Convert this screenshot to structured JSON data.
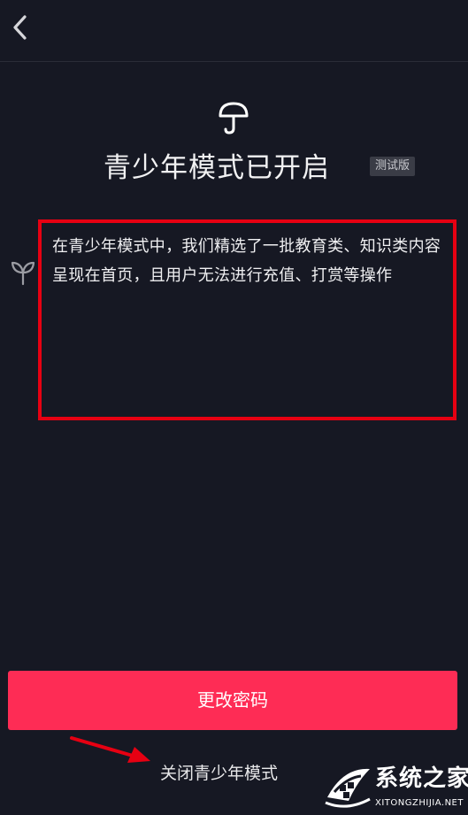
{
  "header": {
    "back_icon": "chevron-left-icon"
  },
  "hero": {
    "icon": "umbrella-icon",
    "title": "青少年模式已开启",
    "badge": "测试版"
  },
  "description": {
    "icon": "sprout-icon",
    "text": "在青少年模式中，我们精选了一批教育类、知识类内容呈现在首页，且用户无法进行充值、打赏等操作"
  },
  "actions": {
    "change_password_label": "更改密码",
    "close_mode_label": "关闭青少年模式"
  },
  "annotation": {
    "box_color": "#e60012",
    "arrow_color": "#e60012"
  },
  "watermark": {
    "name": "系统之家",
    "url": "XITONGZHIJIA.NET"
  },
  "colors": {
    "background": "#161823",
    "primary": "#fe2c55",
    "badge_bg": "#3a3c46"
  }
}
